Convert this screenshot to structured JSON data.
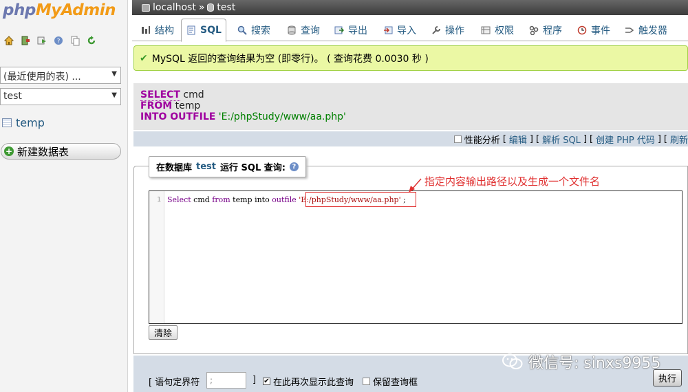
{
  "nav": {
    "logo_part1": "php",
    "logo_part2": "MyAdmin",
    "icons": [
      "home-icon",
      "exit-icon",
      "sql-query-icon",
      "docs-icon",
      "copy-icon",
      "reload-icon"
    ],
    "recent_tables": "(最近使用的表) ...",
    "current_db": "test",
    "tables": [
      {
        "name": "temp"
      }
    ],
    "new_table": "新建数据表"
  },
  "breadcrumb": {
    "server": "localhost",
    "separator": "»",
    "database": "test"
  },
  "tabs": [
    {
      "label": "结构",
      "icon": "structure-icon"
    },
    {
      "label": "SQL",
      "icon": "sql-icon",
      "active": true
    },
    {
      "label": "搜索",
      "icon": "search-icon"
    },
    {
      "label": "查询",
      "icon": "query-icon"
    },
    {
      "label": "导出",
      "icon": "export-icon"
    },
    {
      "label": "导入",
      "icon": "import-icon"
    },
    {
      "label": "操作",
      "icon": "wrench-icon"
    },
    {
      "label": "权限",
      "icon": "privileges-icon"
    },
    {
      "label": "程序",
      "icon": "routines-icon"
    },
    {
      "label": "事件",
      "icon": "events-icon"
    },
    {
      "label": "触发器",
      "icon": "triggers-icon"
    }
  ],
  "success_message": "MySQL 返回的查询结果为空 (即零行)。 ( 查询花费 0.0030 秒 )",
  "executed_sql": {
    "line1_kw": "SELECT",
    "line1_rest": " cmd",
    "line2_kw": "FROM",
    "line2_rest": " temp",
    "line3_kw": "INTO OUTFILE",
    "line3_str": " 'E:/phpStudy/www/aa.php'"
  },
  "links": {
    "profiling": "性能分析",
    "edit": "编辑",
    "explain": "解析 SQL",
    "create_php": "创建 PHP 代码",
    "refresh": "刷新"
  },
  "query_box": {
    "legend_prefix": "在数据库",
    "legend_db": "test",
    "legend_suffix": "运行 SQL 查询:",
    "line_number": "1",
    "code_select": "Select",
    "code_cmd": " cmd ",
    "code_from": "from",
    "code_temp": " temp into ",
    "code_outfile": "outfile",
    "code_path": " 'E:/phpStudy/www/aa.php'",
    "code_end": " ;",
    "annotation": "指定内容输出路径以及生成一个文件名",
    "clear_button": "清除"
  },
  "bottom": {
    "delimiter_label": "[ 语句定界符",
    "delimiter_value": ";",
    "delimiter_close": "]",
    "show_again": "在此再次显示此查询",
    "show_again_checked": true,
    "retain_box": "保留查询框",
    "retain_box_checked": false,
    "go_button": "执行"
  },
  "watermark": "微信号: sinxs9955",
  "colors": {
    "link": "#235a81",
    "keyword": "#9f009f",
    "string": "#008000",
    "annotation": "#e03030",
    "success_bg": "#ebf8a4"
  }
}
